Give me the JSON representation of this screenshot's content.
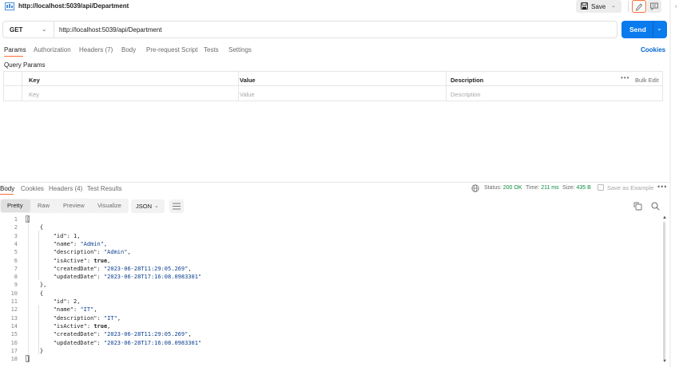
{
  "title_bar": {
    "url": "http://localhost:5039/api/Department",
    "save_label": "Save"
  },
  "request": {
    "method": "GET",
    "url": "http://localhost:5039/api/Department",
    "send_label": "Send"
  },
  "request_tabs": {
    "params": "Params",
    "authorization": "Authorization",
    "headers": "Headers (7)",
    "body": "Body",
    "prerequest": "Pre-request Script",
    "tests": "Tests",
    "settings": "Settings",
    "cookies": "Cookies"
  },
  "query_params": {
    "label": "Query Params",
    "headers": {
      "key": "Key",
      "value": "Value",
      "description": "Description"
    },
    "bulk_edit": "Bulk Edit",
    "placeholders": {
      "key": "Key",
      "value": "Value",
      "description": "Description"
    }
  },
  "response": {
    "tabs": {
      "body": "Body",
      "cookies": "Cookies",
      "headers": "Headers (4)",
      "test_results": "Test Results"
    },
    "status_label": "Status:",
    "status_value": "200 OK",
    "time_label": "Time:",
    "time_value": "211 ms",
    "size_label": "Size:",
    "size_value": "435 B",
    "save_example": "Save as Example",
    "views": {
      "pretty": "Pretty",
      "raw": "Raw",
      "preview": "Preview",
      "visualize": "Visualize"
    },
    "format": "JSON"
  },
  "code_lines": [
    {
      "n": "1",
      "t": "["
    },
    {
      "n": "2",
      "t": "    {"
    },
    {
      "n": "3",
      "t": "        \"id\": 1,"
    },
    {
      "n": "4",
      "t": "        \"name\": \"Admin\","
    },
    {
      "n": "5",
      "t": "        \"description\": \"Admin\","
    },
    {
      "n": "6",
      "t": "        \"isActive\": true,"
    },
    {
      "n": "7",
      "t": "        \"createdDate\": \"2023-06-28T11:29:05.269\","
    },
    {
      "n": "8",
      "t": "        \"updatedDate\": \"2023-06-28T17:16:08.0983301\""
    },
    {
      "n": "9",
      "t": "    },"
    },
    {
      "n": "10",
      "t": "    {"
    },
    {
      "n": "11",
      "t": "        \"id\": 2,"
    },
    {
      "n": "12",
      "t": "        \"name\": \"IT\","
    },
    {
      "n": "13",
      "t": "        \"description\": \"IT\","
    },
    {
      "n": "14",
      "t": "        \"isActive\": true,"
    },
    {
      "n": "15",
      "t": "        \"createdDate\": \"2023-06-28T11:29:05.269\","
    },
    {
      "n": "16",
      "t": "        \"updatedDate\": \"2023-06-28T17:16:08.0983301\""
    },
    {
      "n": "17",
      "t": "    }"
    },
    {
      "n": "18",
      "t": "]"
    }
  ],
  "colors": {
    "accent": "#ff6c37",
    "send_button": "#097bed",
    "status_ok": "#0b8a3f",
    "json_string": "#0b3f8f"
  },
  "icons": [
    "http-request-icon",
    "save-icon",
    "pencil-icon",
    "comment-icon",
    "globe-icon",
    "copy-icon",
    "search-icon",
    "wrap-lines-icon"
  ]
}
